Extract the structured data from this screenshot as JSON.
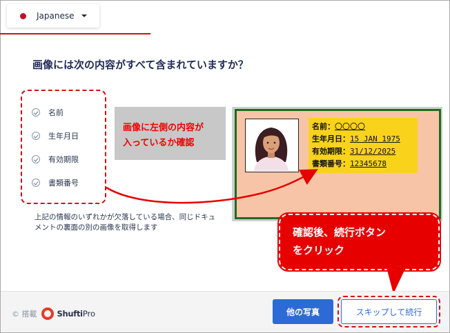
{
  "language": {
    "selected": "Japanese",
    "flag_color": "#c0102a"
  },
  "question": "画像には次の内容がすべて含まれていますか？",
  "checklist": {
    "items": [
      {
        "label": "名前"
      },
      {
        "label": "生年月日"
      },
      {
        "label": "有効期限"
      },
      {
        "label": "書類番号"
      }
    ]
  },
  "note": "上記の情報のいずれかが欠落している場合、同じドキュメントの裏面の別の画像を取得します",
  "annotation": {
    "grey_text_line1": "画像に左側の内容が",
    "grey_text_line2": "入っているか確認",
    "callout_line1": "確認後、続行ボタン",
    "callout_line2": "をクリック"
  },
  "id_card": {
    "fields": [
      {
        "label": "名前：",
        "value": "〇〇〇〇"
      },
      {
        "label": "生年月日：",
        "value": "15 JAN 1975"
      },
      {
        "label": "有効期限：",
        "value": "31/12/2025"
      },
      {
        "label": "書類番号：",
        "value": "12345678"
      }
    ]
  },
  "footer": {
    "powered_by": "© 搭載",
    "brand_name": "Shufti",
    "brand_suffix": "Pro",
    "other_photo_label": "他の写真",
    "skip_continue_label": "スキップして続行"
  },
  "colors": {
    "accent_red": "#d90c12",
    "primary_blue": "#2c6ad6",
    "card_green": "#1f6b1f",
    "field_yellow": "#f9d21b"
  }
}
